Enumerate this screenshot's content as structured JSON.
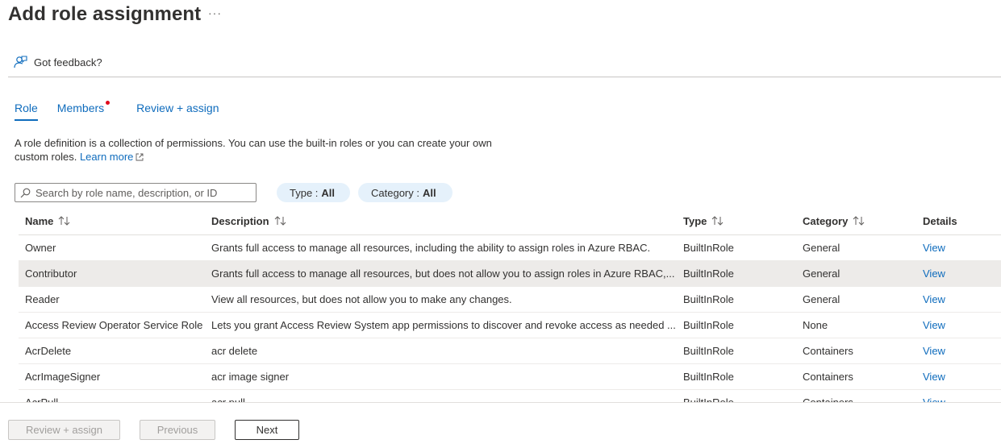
{
  "page": {
    "title": "Add role assignment",
    "more": "···"
  },
  "feedback": {
    "label": "Got feedback?"
  },
  "tabs": [
    {
      "label": "Role",
      "active": true
    },
    {
      "label": "Members",
      "has_dot": true
    },
    {
      "label": "Review + assign"
    }
  ],
  "intro": {
    "text": "A role definition is a collection of permissions. You can use the built-in roles or you can create your own custom roles.",
    "link": "Learn more"
  },
  "search": {
    "placeholder": "Search by role name, description, or ID",
    "value": ""
  },
  "filters": {
    "type": {
      "label": "Type :",
      "value": "All"
    },
    "category": {
      "label": "Category :",
      "value": "All"
    }
  },
  "table": {
    "headers": {
      "name": "Name",
      "description": "Description",
      "type": "Type",
      "category": "Category",
      "details": "Details"
    },
    "rows": [
      {
        "name": "Owner",
        "description": "Grants full access to manage all resources, including the ability to assign roles in Azure RBAC.",
        "type": "BuiltInRole",
        "category": "General",
        "details": "View"
      },
      {
        "name": "Contributor",
        "description": "Grants full access to manage all resources, but does not allow you to assign roles in Azure RBAC,...",
        "type": "BuiltInRole",
        "category": "General",
        "details": "View"
      },
      {
        "name": "Reader",
        "description": "View all resources, but does not allow you to make any changes.",
        "type": "BuiltInRole",
        "category": "General",
        "details": "View"
      },
      {
        "name": "Access Review Operator Service Role",
        "description": "Lets you grant Access Review System app permissions to discover and revoke access as needed ...",
        "type": "BuiltInRole",
        "category": "None",
        "details": "View"
      },
      {
        "name": "AcrDelete",
        "description": "acr delete",
        "type": "BuiltInRole",
        "category": "Containers",
        "details": "View"
      },
      {
        "name": "AcrImageSigner",
        "description": "acr image signer",
        "type": "BuiltInRole",
        "category": "Containers",
        "details": "View"
      },
      {
        "name": "AcrPull",
        "description": "acr pull",
        "type": "BuiltInRole",
        "category": "Containers",
        "details": "View"
      }
    ]
  },
  "footer": {
    "review_label": "Review + assign",
    "previous_label": "Previous",
    "next_label": "Next"
  },
  "colors": {
    "accent": "#0f6cbd",
    "dot": "#e00b1c",
    "pill_bg": "#e5f1fb",
    "row_highlight": "#edebe9"
  }
}
